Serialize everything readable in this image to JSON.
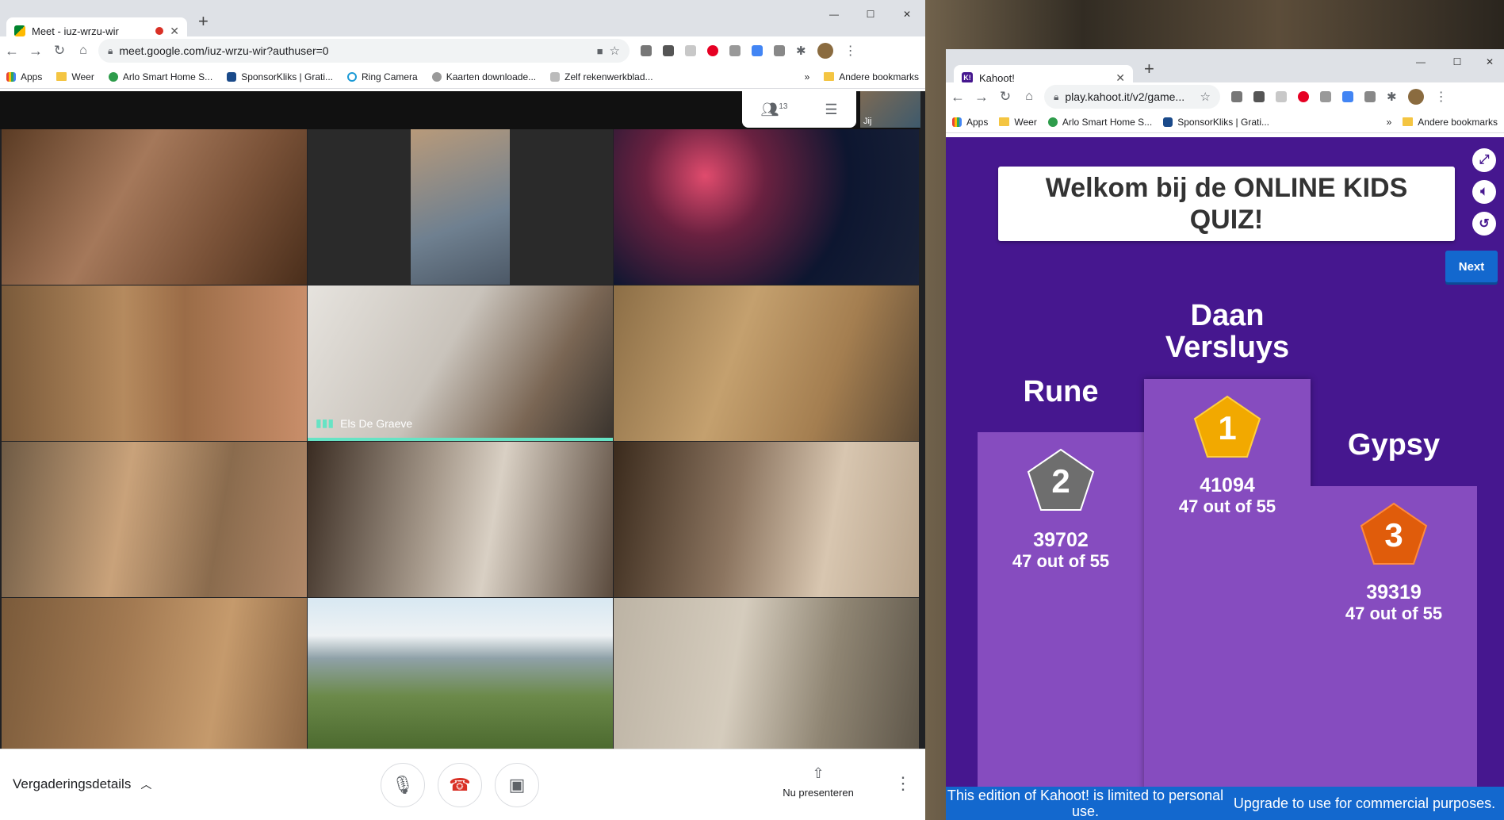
{
  "meet_window": {
    "tab": {
      "title": "Meet - iuz-wrzu-wir",
      "new_tab": "+"
    },
    "controls": {
      "minimize": "—",
      "maximize": "☐",
      "close": "✕"
    },
    "address": {
      "url": "meet.google.com/iuz-wrzu-wir?authuser=0"
    },
    "bookmarks": [
      "Apps",
      "Weer",
      "Arlo Smart Home S...",
      "SponsorKliks | Grati...",
      "Ring Camera",
      "Kaarten downloade...",
      "Zelf rekenwerkblad..."
    ],
    "bookmarks_more": "»",
    "other_bookmarks": "Andere bookmarks",
    "people_count": "13",
    "self_label": "Jij",
    "speaker_name": "Els De Graeve",
    "meeting_details": "Vergaderingsdetails",
    "present_label": "Nu presenteren"
  },
  "kahoot_window": {
    "tab": {
      "title": "Kahoot!",
      "new_tab": "+"
    },
    "controls": {
      "minimize": "—",
      "maximize": "☐",
      "close": "✕"
    },
    "address": {
      "url": "play.kahoot.it/v2/game..."
    },
    "bookmarks": [
      "Apps",
      "Weer",
      "Arlo Smart Home S...",
      "SponsorKliks | Grati..."
    ],
    "bookmarks_more": "»",
    "other_bookmarks": "Andere bookmarks",
    "title": "Welkom bij de ONLINE KIDS QUIZ!",
    "next": "Next",
    "podium": {
      "first": {
        "name": "Daan Versluys",
        "rank": "1",
        "score": "41094",
        "correct": "47 out of 55"
      },
      "second": {
        "name": "Rune",
        "rank": "2",
        "score": "39702",
        "correct": "47 out of 55"
      },
      "third": {
        "name": "Gypsy",
        "rank": "3",
        "score": "39319",
        "correct": "47 out of 55"
      }
    },
    "footer": {
      "left": "This edition of Kahoot! is limited to personal use.",
      "right": "Upgrade to use for commercial purposes."
    }
  },
  "colors": {
    "kahoot_purple": "#46178f",
    "podium": "#864cbf",
    "gold": "#f2a900",
    "silver": "#6e6e6e",
    "bronze": "#e05c0b",
    "next_blue": "#1368ce",
    "meet_red": "#d93025"
  }
}
